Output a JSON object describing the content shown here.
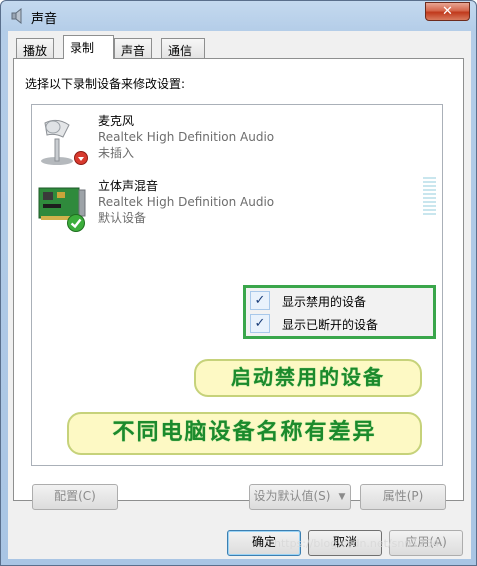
{
  "window": {
    "title": "声音",
    "close_label": "✕"
  },
  "tabs": [
    {
      "label": "播放",
      "active": false
    },
    {
      "label": "录制",
      "active": true
    },
    {
      "label": "声音",
      "active": false
    },
    {
      "label": "通信",
      "active": false
    }
  ],
  "instruction": "选择以下录制设备来修改设置:",
  "devices": [
    {
      "name": "麦克风",
      "driver": "Realtek High Definition Audio",
      "status": "未插入",
      "icon": "microphone-icon",
      "badge": "unplugged-badge-icon"
    },
    {
      "name": "立体声混音",
      "driver": "Realtek High Definition Audio",
      "status": "默认设备",
      "icon": "sound-card-icon",
      "badge": "default-check-badge-icon"
    }
  ],
  "context_menu": {
    "items": [
      {
        "label": "显示禁用的设备",
        "checked": true
      },
      {
        "label": "显示已断开的设备",
        "checked": true
      }
    ],
    "check_glyph": "✓"
  },
  "annotations": {
    "banner1": "启动禁用的设备",
    "banner2": "不同电脑设备名称有差异"
  },
  "buttons": {
    "configure": "配置(C)",
    "set_default": "设为默认值(S)",
    "split_arrow": "▼",
    "properties": "属性(P)",
    "ok": "确定",
    "cancel": "取消",
    "apply": "应用(A)"
  },
  "watermark": "https://blog.csdn.net/snn1234",
  "colors": {
    "accent_green": "#3aa64b",
    "banner_bg": "#fdf9c4",
    "banner_text": "#1c8a2c"
  }
}
